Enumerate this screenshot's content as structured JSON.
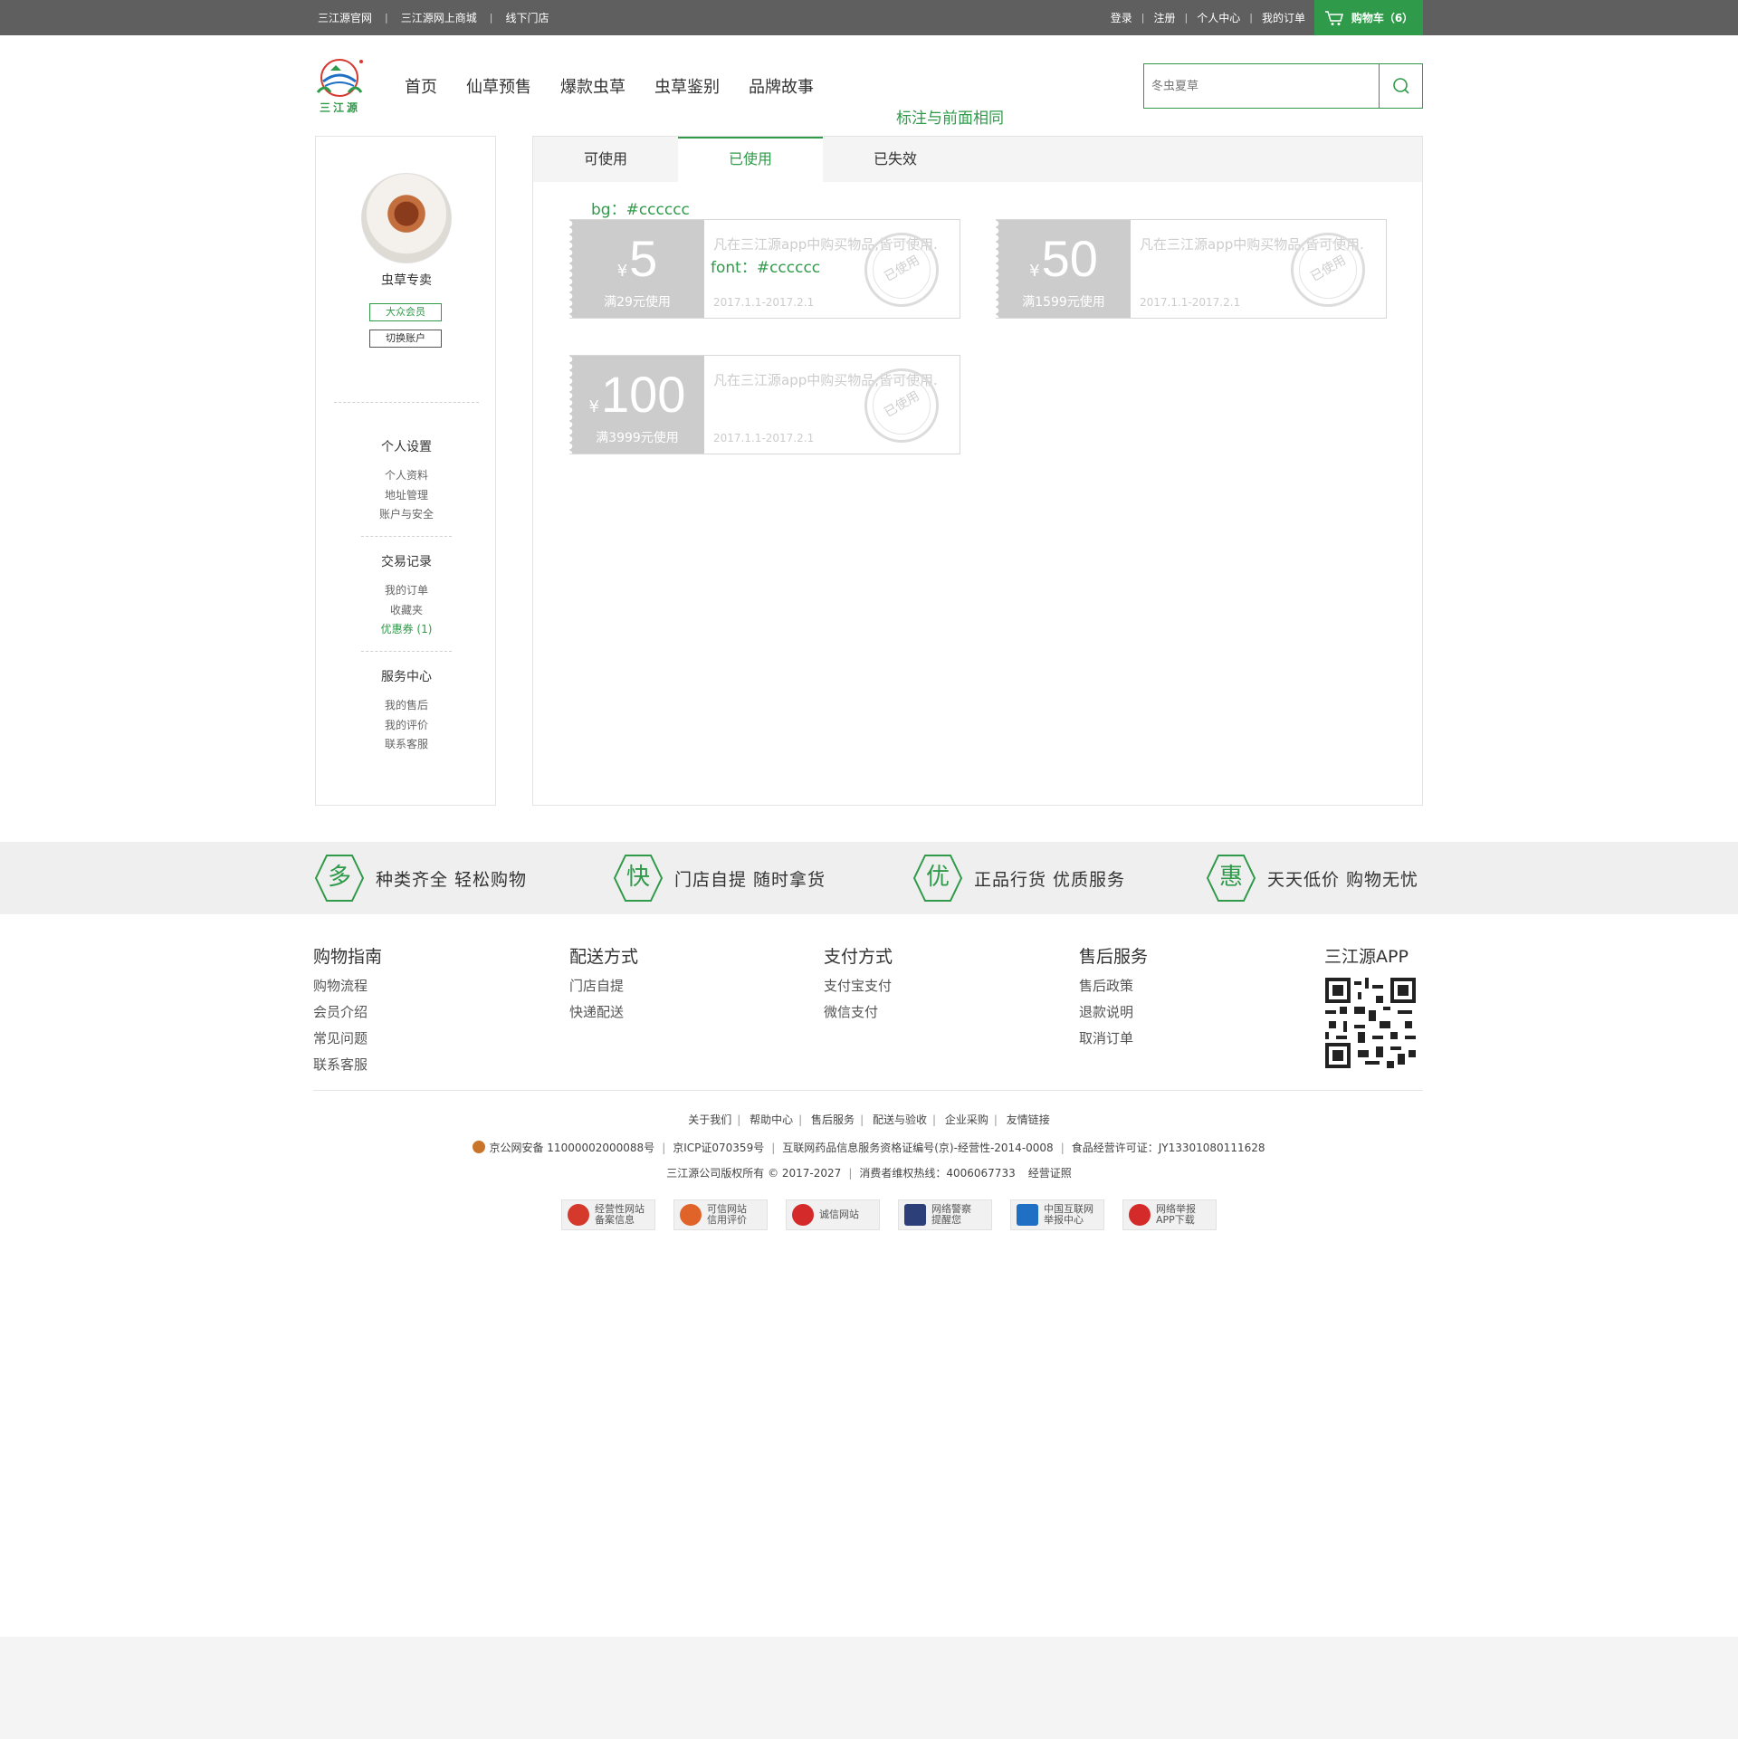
{
  "topbar": {
    "links": [
      "三江源官网",
      "三江源网上商城",
      "线下门店"
    ],
    "right_links": [
      "登录",
      "注册",
      "个人中心",
      "我的订单"
    ],
    "cart_label": "购物车（6）",
    "cart_icon": "cart-icon"
  },
  "header": {
    "logo_text": "三江源",
    "nav": [
      "首页",
      "仙草预售",
      "爆款虫草",
      "虫草鉴别",
      "品牌故事"
    ],
    "search_placeholder": "冬虫夏草",
    "search_icon": "search-icon",
    "annotation": "标注与前面相同"
  },
  "sidebar": {
    "username": "虫草专卖",
    "member_badge": "大众会员",
    "switch_account": "切换账户",
    "sections": [
      {
        "title": "个人设置",
        "items": [
          "个人资料",
          "地址管理",
          "账户与安全"
        ]
      },
      {
        "title": "交易记录",
        "items": [
          "我的订单",
          "收藏夹",
          "优惠券 (1)"
        ]
      },
      {
        "title": "服务中心",
        "items": [
          "我的售后",
          "我的评价",
          "联系客服"
        ]
      }
    ]
  },
  "tabs": [
    "可使用",
    "已使用",
    "已失效"
  ],
  "active_tab": "已使用",
  "annotations": {
    "bg": "bg：#cccccc",
    "font": "font：#cccccc"
  },
  "coupons": [
    {
      "currency": "¥",
      "amount": "5",
      "condition": "满29元使用",
      "desc": "凡在三江源app中购买物品,皆可使用.",
      "date": "2017.1.1-2017.2.1",
      "stamp": "已使用"
    },
    {
      "currency": "¥",
      "amount": "50",
      "condition": "满1599元使用",
      "desc": "凡在三江源app中购买物品,皆可使用.",
      "date": "2017.1.1-2017.2.1",
      "stamp": "已使用"
    },
    {
      "currency": "¥",
      "amount": "100",
      "condition": "满3999元使用",
      "desc": "凡在三江源app中购买物品,皆可使用.",
      "date": "2017.1.1-2017.2.1",
      "stamp": "已使用"
    }
  ],
  "features": [
    {
      "char": "多",
      "text": "种类齐全 轻松购物"
    },
    {
      "char": "快",
      "text": "门店自提  随时拿货"
    },
    {
      "char": "优",
      "text": "正品行货  优质服务"
    },
    {
      "char": "惠",
      "text": "天天低价  购物无忧"
    }
  ],
  "footer": {
    "columns": [
      {
        "title": "购物指南",
        "items": [
          "购物流程",
          "会员介绍",
          "常见问题",
          "联系客服"
        ]
      },
      {
        "title": "配送方式",
        "items": [
          "门店自提",
          "快递配送"
        ]
      },
      {
        "title": "支付方式",
        "items": [
          "支付宝支付",
          "微信支付"
        ]
      },
      {
        "title": "售后服务",
        "items": [
          "售后政策",
          "退款说明",
          "取消订单"
        ]
      }
    ],
    "app_title": "三江源APP",
    "links": [
      "关于我们",
      "帮助中心",
      "售后服务",
      "配送与验收",
      "企业采购",
      "友情链接"
    ],
    "license_line": [
      "京公网安备 11000002000088号",
      "京ICP证070359号",
      "互联网药品信息服务资格证编号(京)-经营性-2014-0008",
      "食品经营许可证：JY13301080111628"
    ],
    "copyright_line": [
      "三江源公司版权所有 © 2017-2027",
      "消费者维权热线：4006067733",
      "经营证照"
    ],
    "certs": [
      {
        "label": [
          "经营性网站",
          "备案信息"
        ],
        "color": "#d4392b"
      },
      {
        "label": [
          "可信网站",
          "信用评价"
        ],
        "color": "#e0642a"
      },
      {
        "label": [
          "诚信网站"
        ],
        "color": "#d42a2a"
      },
      {
        "label": [
          "网络警察",
          "提醒您"
        ],
        "color": "#2c3f78"
      },
      {
        "label": [
          "中国互联网",
          "举报中心"
        ],
        "color": "#1f6fc4"
      },
      {
        "label": [
          "网络举报",
          "APP下载"
        ],
        "color": "#d42a2a"
      }
    ]
  },
  "colors": {
    "accent": "#2f9a49",
    "coupon_bg": "#cccccc",
    "topbar": "#5f5f5f"
  }
}
